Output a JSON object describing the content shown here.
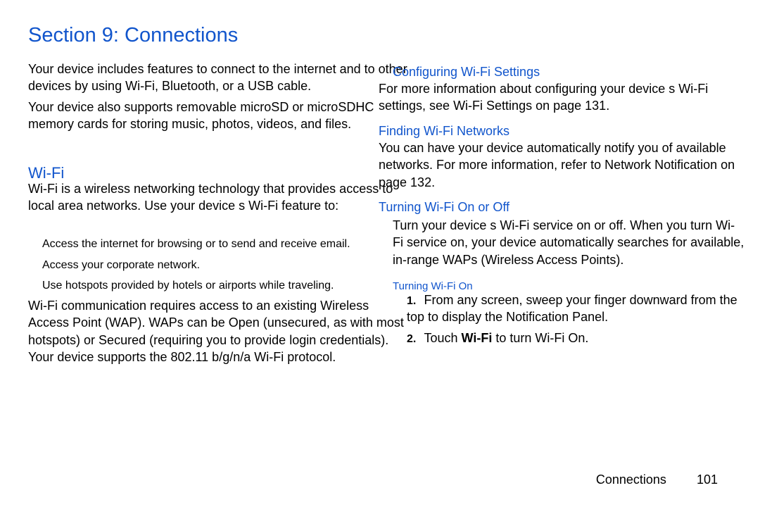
{
  "section_title": "Section 9: Connections",
  "intro_p1": "Your device includes features to connect to the internet and to other devices by using Wi-Fi, Bluetooth, or a USB cable.",
  "intro_p2_pre": "Your device also supports ",
  "intro_p2_bold": "removable",
  "intro_p2_post": " microSD  or microSDHC  memory cards for storing music, photos, videos, and files.",
  "wifi_heading": "Wi-Fi",
  "wifi_p1": "Wi-Fi is a wireless networking technology that provides access to local area networks. Use your device s Wi-Fi feature to:",
  "wifi_b1": "Access the internet for browsing or to send and receive email.",
  "wifi_b2": "Access your corporate network.",
  "wifi_b3_pre": "Use hotspots provided by hotels ",
  "wifi_b3_bold": "or airports",
  "wifi_b3_post": " while traveling.",
  "wifi_p2_pre": "Wi-Fi communication requires access to an existing Wireless Access Point (WAP). WAPs can be Open (unsecured, as with most hotspots) or Secured (requiring ",
  "wifi_p2_mid": "you to provide login credentials). Your device supports the 802.11 b/g/n/a Wi-Fi protocol.",
  "cfg_heading": "Configuring Wi-Fi Settings",
  "cfg_p_pre": "For more information about configuring ",
  "cfg_p_mid": "your device s Wi-Fi settings, see ",
  "cfg_p_link": "Wi-Fi Settings",
  "cfg_p_post": " on page 131.",
  "find_heading": "Finding Wi-Fi Networks",
  "find_p_pre": "You can have your device automatically notify you of available networks. For more information, refer to ",
  "find_p_link": "Network Notification",
  "find_p_post": " on page 132.",
  "turn_heading": "Turning Wi-Fi On or Off",
  "turn_p": "Turn your device s Wi-Fi service on or off. When you turn Wi-Fi service on, your device automatically searches for available, in-range WAPs (Wireless Access Points).",
  "turn_on_heading": "Turning Wi-Fi On",
  "step1_num": "1.",
  "step1_text": "From any screen, sweep your finger downward from the top to display the Notification Panel.",
  "step2_num": "2.",
  "step2_pre": "Touch ",
  "step2_bold": "Wi-Fi",
  "step2_post": " to turn Wi-Fi On.",
  "footer_label": "Connections",
  "footer_page": "101"
}
